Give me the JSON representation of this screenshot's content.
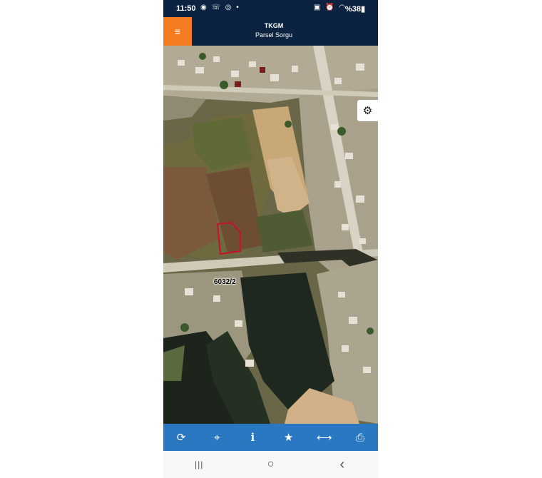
{
  "status_bar": {
    "time": "11:50",
    "left_icons": "◉ ☏ ◎ •",
    "right_icons": "▣ ⏰ ◠",
    "battery": "%38▮"
  },
  "header": {
    "menu_icon": "≡",
    "title": "TKGM",
    "subtitle": "Parsel Sorgu"
  },
  "map": {
    "settings_icon": "⚙",
    "parcel_label": "6032/2",
    "parcel_color": "#c8102e"
  },
  "toolbar": {
    "color": "#2a78c2",
    "refresh_icon": "⟳",
    "locate_icon": "⌖",
    "info_icon": "i",
    "favorite_icon": "★",
    "measure_icon": "⟷",
    "print_icon": "⎙"
  },
  "navbar": {
    "recent_icon": "|||",
    "home_icon": "○",
    "back_icon": "‹"
  },
  "accent_color": "#f47b20",
  "header_color": "#0b2340"
}
